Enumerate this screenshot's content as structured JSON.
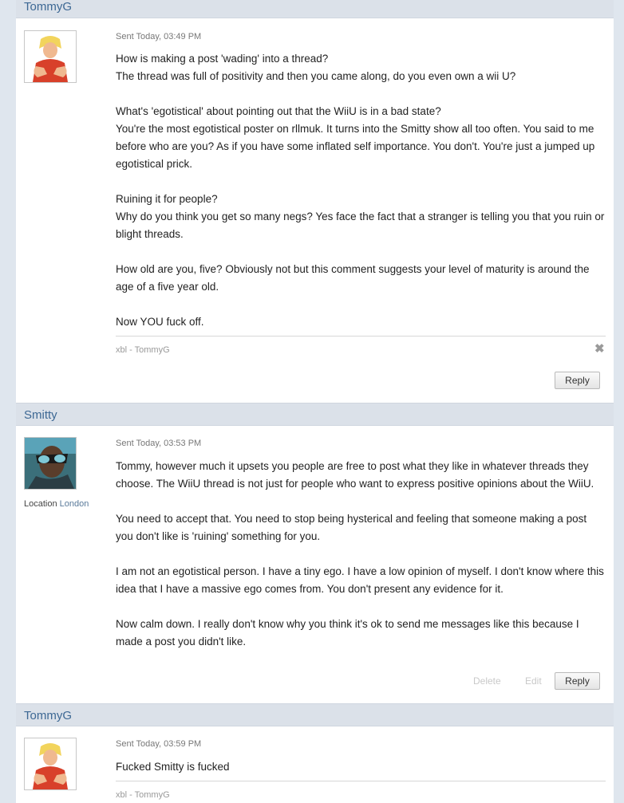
{
  "messages": [
    {
      "username": "TommyG",
      "sent": "Sent Today, 03:49 PM",
      "avatar": "ken-fighter-icon",
      "paragraphs": [
        "How is making a post 'wading' into a thread?\nThe thread was full of positivity and then you came along, do you even own a wii U?",
        "What's 'egotistical' about pointing out that the WiiU is in a bad state?\nYou're the most egotistical poster on rllmuk. It turns into the Smitty show all too often. You said to me before who are you? As if you have some inflated self importance. You don't. You're just a jumped up egotistical prick.",
        "Ruining it for people?\nWhy do you think you get so many negs? Yes face the fact that a stranger is telling you that you ruin or blight threads.",
        "How old are you, five? Obviously not but this comment suggests your level of maturity is around the age of a five year old.",
        "Now YOU fuck off."
      ],
      "signature": "xbl - TommyG",
      "reply_label": "Reply"
    },
    {
      "username": "Smitty",
      "sent": "Sent Today, 03:53 PM",
      "avatar": "sunglasses-man-icon",
      "location_label": "Location",
      "location_value": "London",
      "paragraphs": [
        "Tommy, however much it upsets you people are free to post what they like in whatever threads they choose. The WiiU thread is not just for people who want to express positive opinions about the WiiU.",
        "You need to accept that. You need to stop being hysterical and feeling that someone making a post you don't like is 'ruining' something for you.",
        "I am not an egotistical person. I have a tiny ego. I have a low opinion of myself. I don't know where this idea that I have a massive ego comes from. You don't present any evidence for it.",
        "Now calm down. I really don't know why you think it's ok to send me messages like this because I made a post you didn't like."
      ],
      "delete_label": "Delete",
      "edit_label": "Edit",
      "reply_label": "Reply"
    },
    {
      "username": "TommyG",
      "sent": "Sent Today, 03:59 PM",
      "avatar": "ken-fighter-icon",
      "paragraphs": [
        "Fucked Smitty is fucked"
      ],
      "signature": "xbl - TommyG"
    }
  ],
  "colors": {
    "header_bg": "#dbe1e9",
    "username": "#3d6894",
    "page_bg": "#dfe6ee"
  }
}
